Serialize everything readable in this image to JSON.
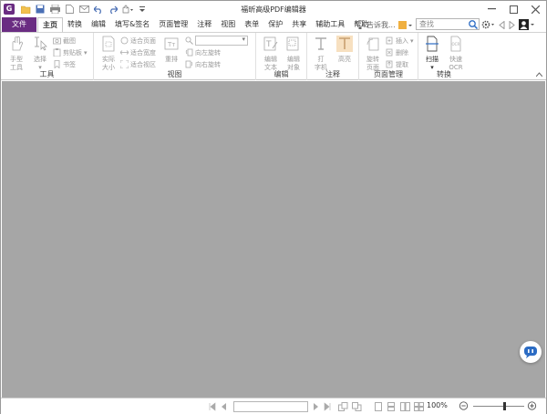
{
  "titlebar": {
    "title": "福昕高级PDF编辑器",
    "app_icon_letter": "G"
  },
  "tabs": {
    "file_label": "文件",
    "items": [
      {
        "label": "主页",
        "active": true
      },
      {
        "label": "转换"
      },
      {
        "label": "编辑"
      },
      {
        "label": "填写&签名"
      },
      {
        "label": "页面管理"
      },
      {
        "label": "注释"
      },
      {
        "label": "视图"
      },
      {
        "label": "表单"
      },
      {
        "label": "保护"
      },
      {
        "label": "共享"
      },
      {
        "label": "辅助工具"
      },
      {
        "label": "帮助"
      }
    ],
    "tellme_label": "告诉我...",
    "search_placeholder": "查找"
  },
  "ribbon": {
    "tools": {
      "group_label": "工具",
      "hand": [
        "手型",
        "工具"
      ],
      "select": "选择",
      "screenshot": "截图",
      "clipboard": "剪贴板",
      "bookmark": "书签"
    },
    "view": {
      "group_label": "视图",
      "actual_size": [
        "实际",
        "大小"
      ],
      "fit_page": "适合页面",
      "fit_width": "适合宽度",
      "fit_visible": "适合视区",
      "reflow": "重排",
      "rotate_left": "向左旋转",
      "rotate_right": "向右旋转"
    },
    "edit": {
      "group_label": "编辑",
      "edit_text": [
        "编辑",
        "文本"
      ],
      "edit_object": [
        "编辑",
        "对象"
      ]
    },
    "comment": {
      "group_label": "注释",
      "typewriter": [
        "打",
        "字机"
      ],
      "highlight": "高亮"
    },
    "pages": {
      "group_label": "页面管理",
      "rotate_page": [
        "旋转",
        "页面"
      ],
      "insert": "插入",
      "delete": "删除",
      "extract": "提取"
    },
    "convert": {
      "group_label": "转换",
      "scan": "扫描",
      "quick_ocr": [
        "快速",
        "OCR"
      ]
    }
  },
  "status": {
    "zoom": "100%",
    "zoom_fraction": 0.6
  },
  "colors": {
    "accent": "#6a2c82",
    "doc_bg": "#a6a6a6"
  }
}
